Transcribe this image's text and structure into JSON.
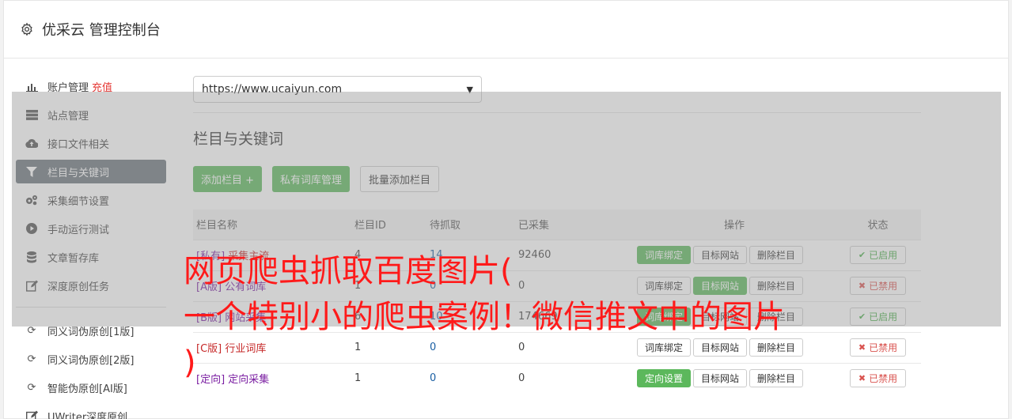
{
  "header": {
    "title": "优采云 管理控制台",
    "icon": "gear-icon"
  },
  "sidebar": {
    "items": [
      {
        "label": "账户管理",
        "extra": "充值",
        "icon": "bar-chart-icon"
      },
      {
        "label": "站点管理",
        "icon": "server-icon"
      },
      {
        "label": "接口文件相关",
        "icon": "cloud-upload-icon"
      },
      {
        "label": "栏目与关键词",
        "icon": "filter-icon",
        "active": true
      },
      {
        "label": "采集细节设置",
        "icon": "cogs-icon"
      },
      {
        "label": "手动运行测试",
        "icon": "play-circle-icon"
      },
      {
        "label": "文章暂存库",
        "icon": "database-icon"
      },
      {
        "label": "深度原创任务",
        "icon": "edit-icon"
      }
    ],
    "items2": [
      {
        "label": "同义词伪原创[1版]",
        "icon": "refresh-icon"
      },
      {
        "label": "同义词伪原创[2版]",
        "icon": "refresh-icon"
      },
      {
        "label": "智能伪原创[AI版]",
        "icon": "refresh-icon"
      },
      {
        "label": "UWriter深度原创",
        "icon": "edit-icon"
      }
    ]
  },
  "main": {
    "site_select": "https://www.ucaiyun.com",
    "section_title": "栏目与关键词",
    "buttons": {
      "add": "添加栏目 +",
      "private": "私有词库管理",
      "batch": "批量添加栏目"
    },
    "table": {
      "headers": [
        "栏目名称",
        "栏目ID",
        "待抓取",
        "已采集",
        "操作",
        "状态"
      ],
      "rows": [
        {
          "tag": "[私有]",
          "name": "采集主流",
          "id": "4",
          "wait": "14",
          "done": "92460",
          "op1": "词库绑定",
          "op2": "目标网站",
          "op3": "删除栏目",
          "status": "已启用"
        },
        {
          "tag": "[A版]",
          "name": "公有词库",
          "id": "1",
          "wait": "0",
          "done": "0",
          "op1": "词库绑定",
          "op2": "目标网站",
          "op3": "删除栏目",
          "status": "已禁用"
        },
        {
          "tag": "[B版]",
          "name": "网站采集",
          "id": "6",
          "wait": "10",
          "done": "174669",
          "op1": "词库绑定",
          "op2": "目标网站",
          "op3": "删除栏目",
          "status": "已启用"
        },
        {
          "tag": "[C版]",
          "name": "行业词库",
          "id": "1",
          "wait": "0",
          "done": "0",
          "op1": "词库绑定",
          "op2": "目标网站",
          "op3": "删除栏目",
          "status": "已禁用"
        },
        {
          "tag": "[定向]",
          "name": "定向采集",
          "id": "1",
          "wait": "0",
          "done": "0",
          "op1": "定向设置",
          "op2": "目标网站",
          "op3": "删除栏目",
          "status": "已禁用"
        }
      ]
    }
  },
  "overlay_text": {
    "line1": "网页爬虫抓取百度图片(",
    "line2": "一个特别小的爬虫案例！微信推文中的图片",
    "line3": ")"
  },
  "colors": {
    "accent_green": "#5cb85c",
    "active_nav": "#6c757d",
    "overlay_text": "#ff1a1a"
  }
}
